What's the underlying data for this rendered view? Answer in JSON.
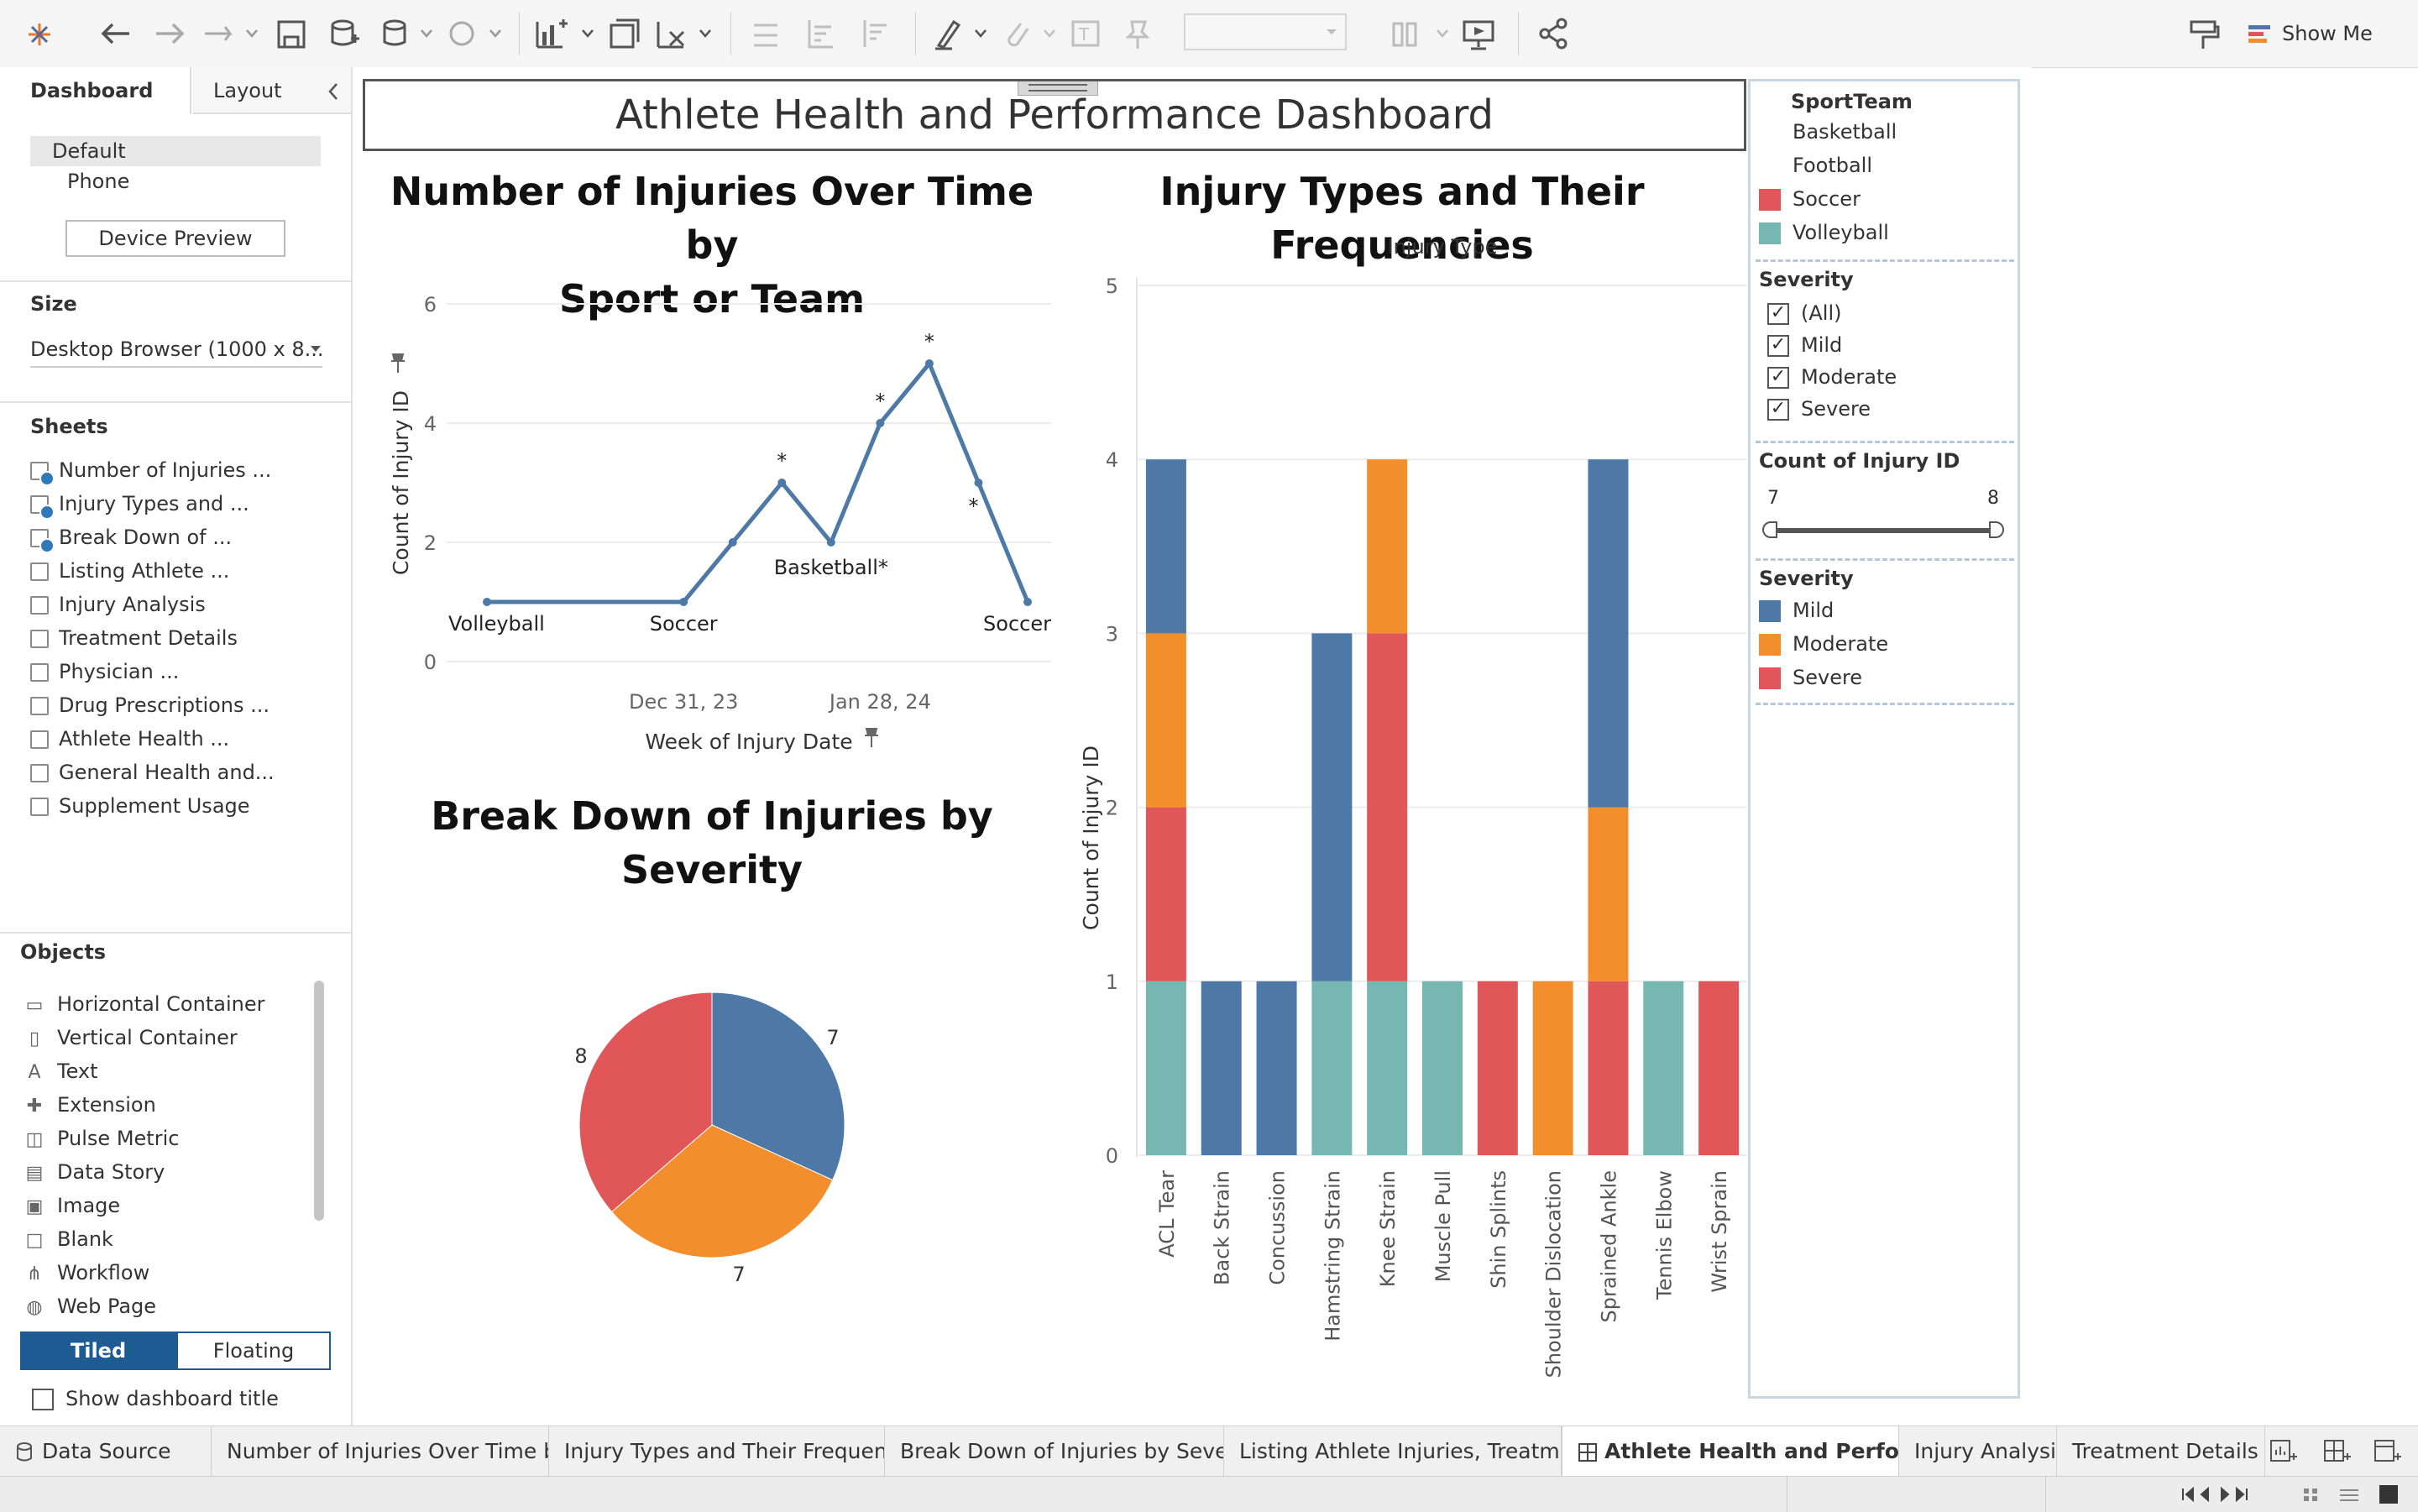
{
  "toolbar": {
    "show_me": "Show Me"
  },
  "left_panel": {
    "tabs": [
      "Dashboard",
      "Layout"
    ],
    "device": {
      "default": "Default",
      "phone": "Phone",
      "preview_button": "Device Preview"
    },
    "size": {
      "title": "Size",
      "value": "Desktop Browser (1000 x 8..."
    },
    "sheets": {
      "title": "Sheets",
      "items": [
        {
          "label": "Number of Injuries ...",
          "used": true
        },
        {
          "label": "Injury Types and ...",
          "used": true
        },
        {
          "label": "Break Down of ...",
          "used": true
        },
        {
          "label": "Listing Athlete ...",
          "used": false
        },
        {
          "label": "Injury Analysis",
          "used": false
        },
        {
          "label": "Treatment Details",
          "used": false
        },
        {
          "label": "Physician ...",
          "used": false
        },
        {
          "label": "Drug Prescriptions ...",
          "used": false
        },
        {
          "label": "Athlete Health ...",
          "used": false
        },
        {
          "label": "General Health and...",
          "used": false
        },
        {
          "label": "Supplement Usage",
          "used": false
        }
      ]
    },
    "objects": {
      "title": "Objects",
      "items": [
        {
          "label": "Horizontal Container",
          "glyph": "▭"
        },
        {
          "label": "Vertical Container",
          "glyph": "▯"
        },
        {
          "label": "Text",
          "glyph": "A"
        },
        {
          "label": "Extension",
          "glyph": "✚"
        },
        {
          "label": "Pulse Metric",
          "glyph": "◫"
        },
        {
          "label": "Data Story",
          "glyph": "▤"
        },
        {
          "label": "Image",
          "glyph": "▣"
        },
        {
          "label": "Blank",
          "glyph": "□"
        },
        {
          "label": "Workflow",
          "glyph": "⋔"
        },
        {
          "label": "Web Page",
          "glyph": "◍"
        }
      ],
      "tiled": "Tiled",
      "floating": "Floating",
      "show_title": "Show dashboard title"
    }
  },
  "dashboard": {
    "title": "Athlete Health and Performance Dashboard",
    "line_title_1": "Number of Injuries Over Time by",
    "line_title_2": "Sport or Team",
    "bar_title": "Injury Types and Their Frequencies",
    "pie_title": "Break Down of Injuries by Severity"
  },
  "filters": {
    "sport_title": "SportTeam",
    "sports": [
      {
        "label": "Basketball",
        "color": "#4e79a7",
        "show_swatch": false
      },
      {
        "label": "Football",
        "color": "#f28e2b",
        "show_swatch": false
      },
      {
        "label": "Soccer",
        "color": "#e15759",
        "show_swatch": true
      },
      {
        "label": "Volleyball",
        "color": "#76b7b2",
        "show_swatch": true
      }
    ],
    "severity_filter_title": "Severity",
    "severity_options": [
      "(All)",
      "Mild",
      "Moderate",
      "Severe"
    ],
    "count_title": "Count of Injury ID",
    "count_min": "7",
    "count_max": "8",
    "severity_legend_title": "Severity",
    "severity_legend": [
      {
        "label": "Mild",
        "color": "#4e79a7"
      },
      {
        "label": "Moderate",
        "color": "#f28e2b"
      },
      {
        "label": "Severe",
        "color": "#e15759"
      }
    ]
  },
  "bottom_tabs": [
    "Data Source",
    "Number of Injuries Over Time by...",
    "Injury Types and Their Frequenc...",
    "Break Down of Injuries by Severity",
    "Listing Athlete Injuries, Treatme...",
    "Athlete Health and Perform...",
    "Injury Analysis",
    "Treatment Details"
  ],
  "chart_data": [
    {
      "type": "line",
      "title": "Number of Injuries Over Time by Sport or Team",
      "xlabel": "Week of Injury Date",
      "ylabel": "Count of Injury ID",
      "x_ticks": [
        "Dec 31, 23",
        "Jan 28, 24"
      ],
      "y_ticks": [
        0,
        2,
        4,
        6
      ],
      "ylim": [
        0,
        6
      ],
      "x": [
        "2023-12-03",
        "2023-12-31",
        "2024-01-07",
        "2024-01-14",
        "2024-01-21",
        "2024-01-28",
        "2024-02-04",
        "2024-02-11",
        "2024-02-18"
      ],
      "values": [
        1,
        1,
        2,
        3,
        2,
        4,
        5,
        3,
        1
      ],
      "color": "#4e79a7",
      "mark_labels": [
        {
          "index": 0,
          "text": "Volleyball"
        },
        {
          "index": 1,
          "text": "Soccer"
        },
        {
          "index": 3,
          "text": "*"
        },
        {
          "index": 4,
          "text": "Basketball*"
        },
        {
          "index": 5,
          "text": "*"
        },
        {
          "index": 6,
          "text": "*"
        },
        {
          "index": 7,
          "text": "*"
        },
        {
          "index": 8,
          "text": "Soccer"
        }
      ],
      "grid": true
    },
    {
      "type": "bar",
      "stacked": true,
      "title": "Injury Types and Their Frequencies",
      "xlabel": "Injury Type",
      "ylabel": "Count of Injury ID",
      "ylim": [
        0,
        5
      ],
      "y_ticks": [
        0,
        1,
        2,
        3,
        4,
        5
      ],
      "categories": [
        "ACL Tear",
        "Back Strain",
        "Concussion",
        "Hamstring Strain",
        "Knee Strain",
        "Muscle Pull",
        "Shin Splints",
        "Shoulder Dislocation",
        "Sprained Ankle",
        "Tennis Elbow",
        "Wrist Sprain"
      ],
      "stacks": [
        [
          {
            "v": 1,
            "c": "#76b7b2"
          },
          {
            "v": 1,
            "c": "#e15759"
          },
          {
            "v": 1,
            "c": "#f28e2b"
          },
          {
            "v": 1,
            "c": "#4e79a7"
          }
        ],
        [
          {
            "v": 1,
            "c": "#4e79a7"
          }
        ],
        [
          {
            "v": 1,
            "c": "#4e79a7"
          }
        ],
        [
          {
            "v": 1,
            "c": "#76b7b2"
          },
          {
            "v": 2,
            "c": "#4e79a7"
          }
        ],
        [
          {
            "v": 1,
            "c": "#76b7b2"
          },
          {
            "v": 2,
            "c": "#e15759"
          },
          {
            "v": 1,
            "c": "#f28e2b"
          }
        ],
        [
          {
            "v": 1,
            "c": "#76b7b2"
          }
        ],
        [
          {
            "v": 1,
            "c": "#e15759"
          }
        ],
        [
          {
            "v": 1,
            "c": "#f28e2b"
          }
        ],
        [
          {
            "v": 1,
            "c": "#e15759"
          },
          {
            "v": 1,
            "c": "#f28e2b"
          },
          {
            "v": 2,
            "c": "#4e79a7"
          }
        ],
        [
          {
            "v": 1,
            "c": "#76b7b2"
          }
        ],
        [
          {
            "v": 1,
            "c": "#e15759"
          }
        ]
      ],
      "grid": true
    },
    {
      "type": "pie",
      "title": "Break Down of Injuries by Severity",
      "slices": [
        {
          "label": "Mild",
          "value": 7,
          "color": "#4e79a7"
        },
        {
          "label": "Moderate",
          "value": 7,
          "color": "#f28e2b"
        },
        {
          "label": "Severe",
          "value": 8,
          "color": "#e15759"
        }
      ]
    }
  ]
}
